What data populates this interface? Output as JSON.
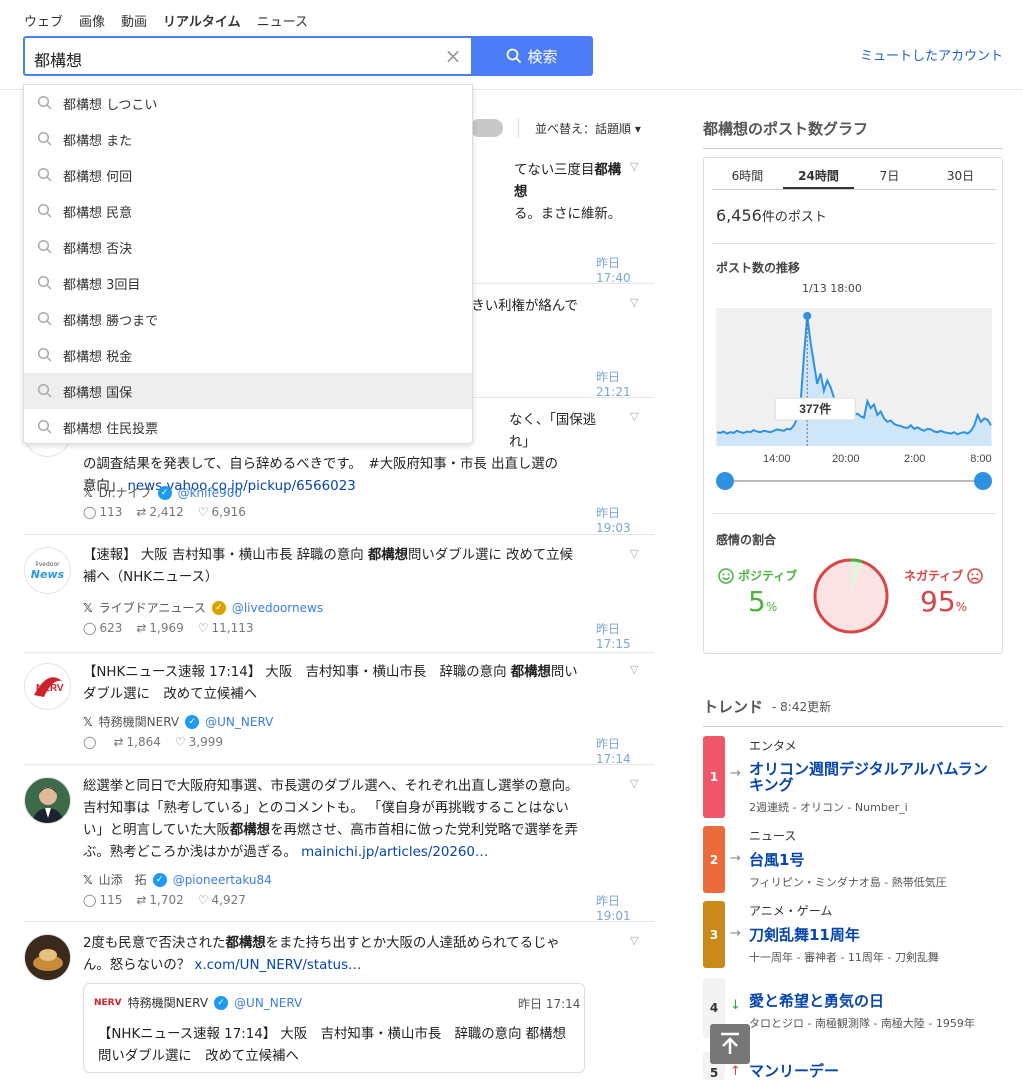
{
  "nav": {
    "items": [
      "ウェブ",
      "画像",
      "動画",
      "リアルタイム",
      "ニュース"
    ],
    "active": "リアルタイム"
  },
  "search": {
    "query": "都構想",
    "button_label": "検索",
    "clear": "×"
  },
  "muted_accounts_label": "ミュートしたアカウント",
  "suggestions": [
    "都構想 しつこい",
    "都構想 また",
    "都構想 何回",
    "都構想 民意",
    "都構想 否決",
    "都構想 3回目",
    "都構想 勝つまで",
    "都構想 税金",
    "都構想 国保",
    "都構想 住民投票"
  ],
  "sort": {
    "label": "並べ替え：話題順 ▾"
  },
  "posts": [
    {
      "text_a": "てない三度目",
      "bold": "都構想",
      "line2": "る。まさに維新。",
      "time": "昨日 17:40"
    },
    {
      "text_a": "大きい利権が絡んで",
      "time": "昨日 21:21"
    },
    {
      "line1": "なく、「国保逃れ」",
      "line2": "の調査結果を発表して、自ら辞めるべきです。　#大阪府知事・市長 出直し選の",
      "line3a": "意向」",
      "link": "news.yahoo.co.jp/pickup/6566023",
      "author": "Dr.ナイフ",
      "handle": "@knife900",
      "replies": "113",
      "retweets": "2,412",
      "likes": "6,916",
      "time": "昨日 19:03"
    },
    {
      "line1a": "【速報】 大阪 吉村知事・横山市長 辞職の意向 ",
      "bold": "都構想",
      "line1b": "問いダブル選に 改めて立候",
      "line2": "補へ（NHKニュース）",
      "author": "ライブドアニュース",
      "handle": "@livedoornews",
      "replies": "623",
      "retweets": "1,969",
      "likes": "11,113",
      "time": "昨日 17:15",
      "avatar_text_top": "livedoor",
      "avatar_text": "News"
    },
    {
      "line1a": "【NHKニュース速報 17:14】 大阪　吉村知事・横山市長　辞職の意向 ",
      "bold": "都構想",
      "line1b": "問い",
      "line2": "ダブル選に　改めて立候補へ",
      "author": "特務機関NERV",
      "handle": "@UN_NERV",
      "replies": "",
      "retweets": "1,864",
      "likes": "3,999",
      "time": "昨日 17:14"
    },
    {
      "line1": "総選挙と同日で大阪府知事選、市長選のダブル選へ、それぞれ出直し選挙の意向。",
      "line2": "吉村知事は「熟考している」とのコメントも。 「僕自身が再挑戦することはない",
      "line3a": "い」と明言していた大阪",
      "bold": "都構想",
      "line3b": "を再燃させ、高市首相に倣った党利党略で選挙を弄",
      "line4a": "ぶ。熟考どころか浅はかが過ぎる。 ",
      "link": "mainichi.jp/articles/20260…",
      "author": "山添　拓",
      "handle": "@pioneertaku84",
      "replies": "115",
      "retweets": "1,702",
      "likes": "4,927",
      "time": "昨日 19:01"
    },
    {
      "line1a": "2度も民意で否決された",
      "bold": "都構想",
      "line1b": "をまた持ち出すとか大阪の人達舐められてるじゃ",
      "line2a": "ん。怒らないの？ ",
      "link": "x.com/UN_NERV/status…",
      "quote_author": "特務機関NERV",
      "quote_handle": "@UN_NERV",
      "quote_time": "昨日 17:14",
      "quote_line1": "【NHKニュース速報 17:14】 大阪　吉村知事・横山市長　辞職の意向 都構想",
      "quote_line2": "問いダブル選に　改めて立候補へ"
    }
  ],
  "graph": {
    "title": "都構想のポスト数グラフ",
    "tabs": [
      "6時間",
      "24時間",
      "7日",
      "30日"
    ],
    "selected_tab": "24時間",
    "count": "6,456",
    "count_unit": "件のポスト",
    "trend_heading": "ポスト数の推移",
    "peak_date": "1/13 18:00",
    "peak_label": "377件",
    "sentiment_heading": "感情の割合",
    "positive_label": "ポジティブ",
    "positive_value": "5",
    "negative_label": "ネガティブ",
    "negative_value": "95",
    "percent": "%"
  },
  "chart_data": {
    "type": "area",
    "x_ticks": [
      "14:00",
      "20:00",
      "2:00",
      "8:00"
    ],
    "peak_x": "1/13 18:00",
    "peak_value": 377,
    "values": [
      40,
      38,
      42,
      36,
      40,
      38,
      44,
      40,
      38,
      42,
      40,
      46,
      42,
      40,
      44,
      42,
      40,
      44,
      48,
      46,
      44,
      50,
      48,
      60,
      80,
      120,
      260,
      377,
      300,
      240,
      180,
      210,
      160,
      190,
      170,
      140,
      120,
      130,
      110,
      100,
      96,
      90,
      94,
      86,
      82,
      130,
      110,
      120,
      90,
      100,
      80,
      70,
      74,
      64,
      60,
      58,
      54,
      52,
      60,
      50,
      54,
      48,
      44,
      50,
      48,
      42,
      40,
      44,
      40,
      38,
      36,
      40,
      34,
      38,
      40,
      36,
      44,
      60,
      90,
      70,
      80,
      76,
      60
    ]
  },
  "trends": {
    "title": "トレンド",
    "updated": "8:42更新",
    "items": [
      {
        "rank": "1",
        "arrow": "→",
        "category": "エンタメ",
        "keyword": "オリコン週間デジタルアルバムランキング",
        "sub": "2週連続 - オリコン - Number_i",
        "color": "#f0566a"
      },
      {
        "rank": "2",
        "arrow": "→",
        "category": "ニュース",
        "keyword": "台風1号",
        "sub": "フィリピン・ミンダナオ島 - 熱帯低気圧",
        "color": "#eb6c3a"
      },
      {
        "rank": "3",
        "arrow": "→",
        "category": "アニメ・ゲーム",
        "keyword": "刀剣乱舞11周年",
        "sub": "十一周年 - 審神者 - 11周年 - 刀剣乱舞",
        "color": "#c9891b"
      },
      {
        "rank": "4",
        "arrow": "↓",
        "category": "",
        "keyword": "愛と希望と勇気の日",
        "sub": "タロとジロ - 南極観測隊 - 南極大陸 - 1959年",
        "color": "#f3f3f3"
      },
      {
        "rank": "5",
        "arrow": "↑",
        "category": "",
        "keyword": "マンリーデー",
        "sub": "",
        "color": "#f3f3f3"
      }
    ]
  }
}
